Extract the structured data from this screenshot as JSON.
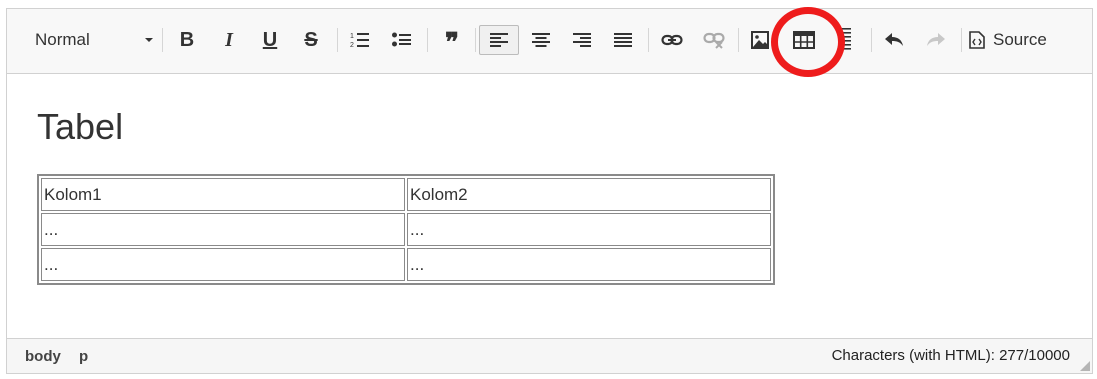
{
  "toolbar": {
    "format_value": "Normal",
    "bold_label": "B",
    "italic_label": "I",
    "underline_label": "U",
    "strike_label": "S",
    "quote_label": "❞",
    "source_label": "Source",
    "highlight_color": "#ee1c1c"
  },
  "content": {
    "heading": "Tabel",
    "table": {
      "rows": [
        [
          "Kolom1",
          "Kolom2"
        ],
        [
          "...",
          "..."
        ],
        [
          "...",
          "..."
        ]
      ]
    }
  },
  "statusbar": {
    "path": [
      "body",
      "p"
    ],
    "counter": "Characters (with HTML): 277/10000"
  }
}
